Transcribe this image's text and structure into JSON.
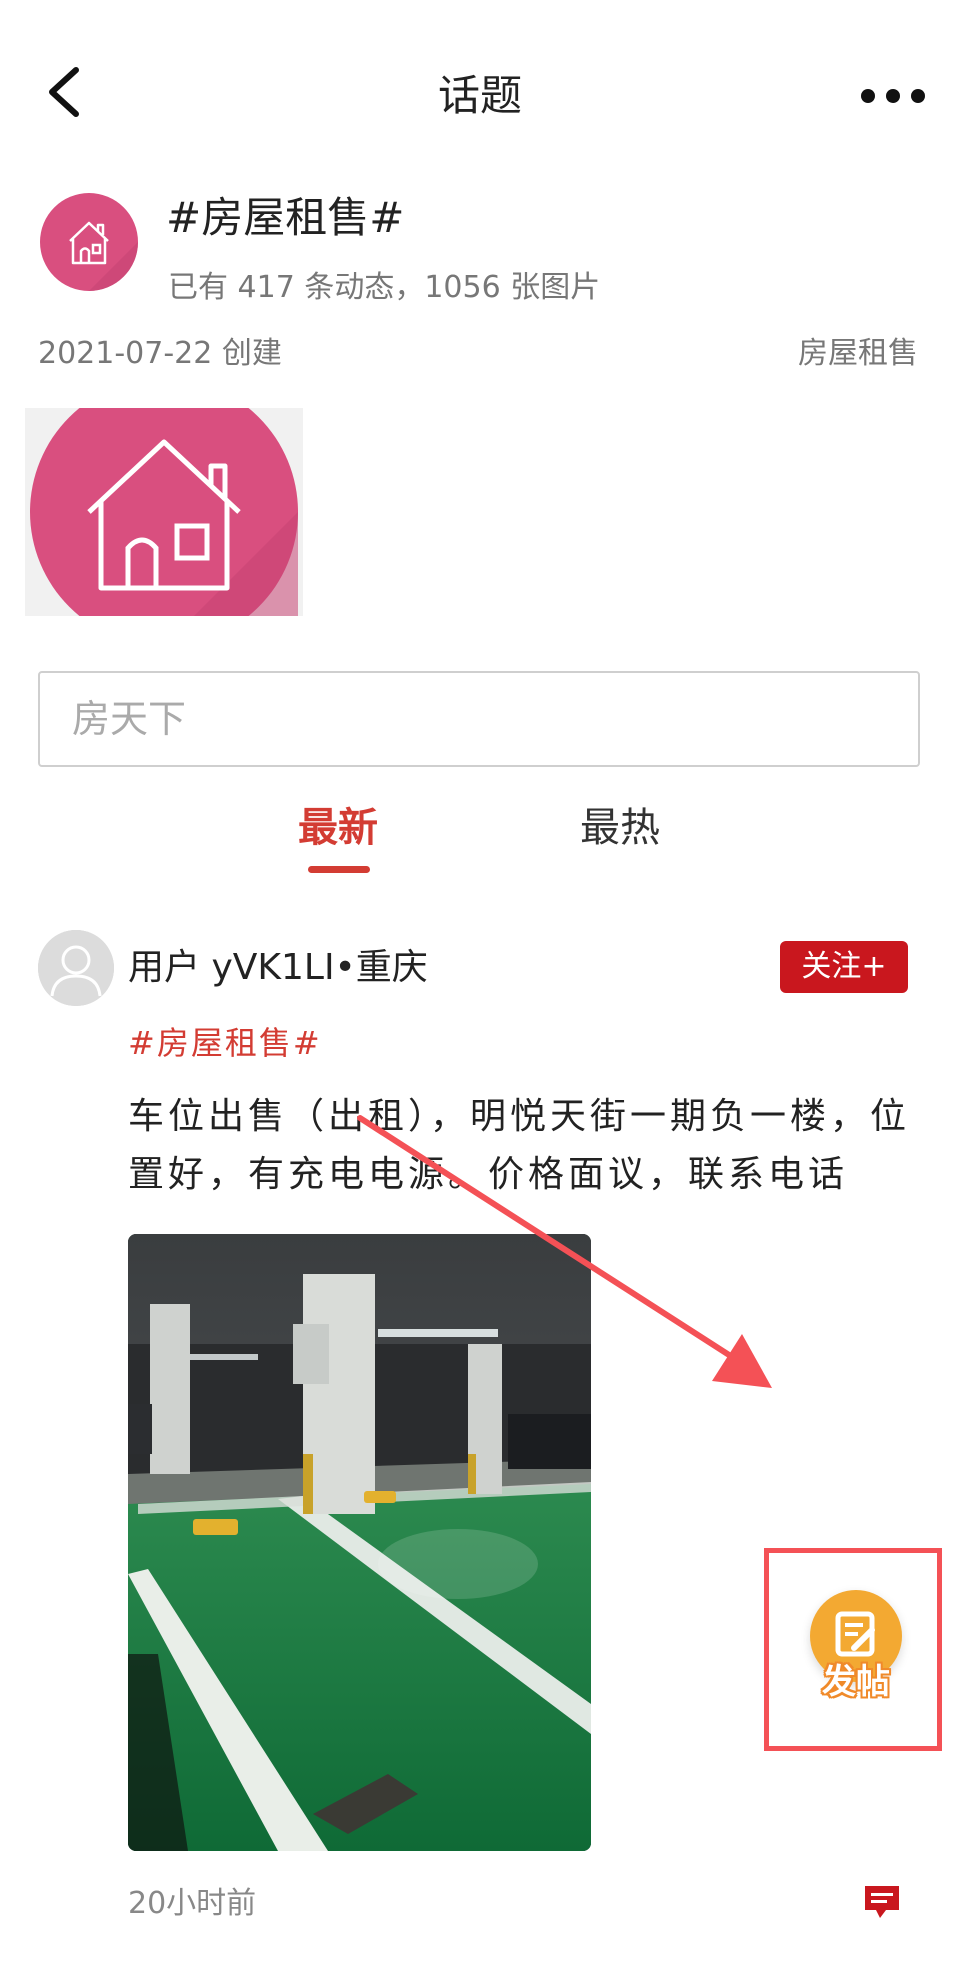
{
  "header": {
    "title": "话题",
    "back_icon": "chevron-left-icon",
    "more_icon": "more-horizontal-icon"
  },
  "topic": {
    "name": "#房屋租售#",
    "stats": "已有 417 条动态，1056 张图片",
    "created": "2021-07-22 创建",
    "category": "房屋租售",
    "icon": "house-icon",
    "accent_color": "#d94f7f"
  },
  "search": {
    "placeholder": "房天下"
  },
  "tabs": [
    {
      "label": "最新",
      "active": true
    },
    {
      "label": "最热",
      "active": false
    }
  ],
  "post": {
    "user": "用户 yVK1LI•重庆",
    "follow_label": "关注+",
    "topic_tag": "#房屋租售#",
    "text": "车位出售（出租），明悦天街一期负一楼，位置好，有充电电源。价格面议，联系电话",
    "time": "20小时前",
    "image": "parking-garage-photo",
    "comment_icon": "comment-icon"
  },
  "fab": {
    "label": "发帖",
    "icon": "edit-icon",
    "color": "#f3a932"
  },
  "colors": {
    "accent_red": "#d33c33",
    "follow_red": "#c9171e",
    "annotation_red": "#f45156"
  }
}
